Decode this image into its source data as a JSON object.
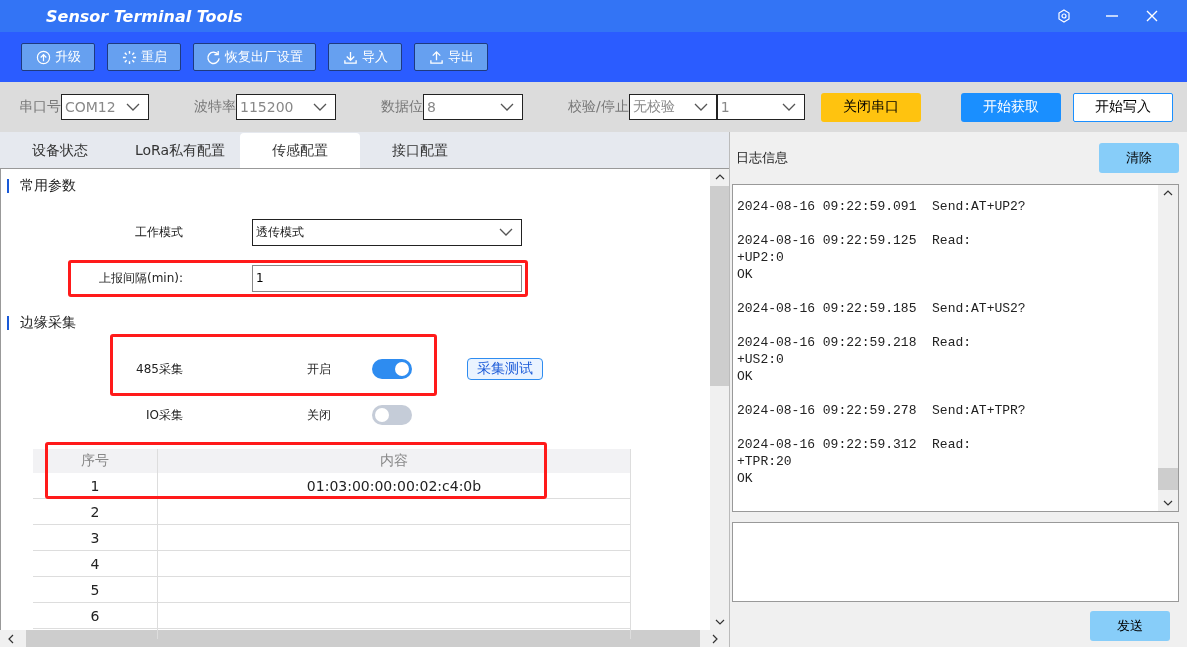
{
  "window": {
    "title": "Sensor Terminal Tools"
  },
  "toolbar": [
    {
      "label": "升级"
    },
    {
      "label": "重启"
    },
    {
      "label": "恢复出厂设置"
    },
    {
      "label": "导入"
    },
    {
      "label": "导出"
    }
  ],
  "serial": {
    "fields": [
      {
        "label": "串口号",
        "value": "COM12"
      },
      {
        "label": "波特率",
        "value": "115200"
      },
      {
        "label": "数据位",
        "value": "8"
      },
      {
        "label": "校验/停止",
        "value": "无校验"
      },
      {
        "value": "1"
      }
    ],
    "close_button": "关闭串口",
    "fetch_button": "开始获取",
    "write_button": "开始写入"
  },
  "tabs": [
    {
      "label": "设备状态",
      "selected": false
    },
    {
      "label": "LoRa私有配置",
      "selected": false
    },
    {
      "label": "传感配置",
      "selected": true
    },
    {
      "label": "接口配置",
      "selected": false
    }
  ],
  "sections": [
    {
      "title": "常用参数",
      "fields": [
        {
          "kind": "select",
          "label": "工作模式",
          "value": "透传模式"
        },
        {
          "kind": "input",
          "label": "上报间隔(min):",
          "value": "1"
        }
      ]
    },
    {
      "title": "边缘采集",
      "fields": [
        {
          "kind": "switch",
          "label": "485采集",
          "state": "开启",
          "on": true,
          "button": "采集测试"
        },
        {
          "kind": "switch",
          "label": "IO采集",
          "state": "关闭",
          "on": false
        }
      ]
    }
  ],
  "table": {
    "columns": [
      "序号",
      "内容"
    ],
    "rows": [
      [
        "1",
        "01:03:00:00:00:02:c4:0b"
      ],
      [
        "2",
        ""
      ],
      [
        "3",
        ""
      ],
      [
        "4",
        ""
      ],
      [
        "5",
        ""
      ],
      [
        "6",
        ""
      ]
    ]
  },
  "log": {
    "title": "日志信息",
    "clear_button": "清除",
    "send_button": "发送",
    "entries": [
      {
        "lines": [
          "2024-08-16 09:22:59.091  Send:AT+UP2?"
        ]
      },
      {
        "lines": [
          "2024-08-16 09:22:59.125  Read:",
          "+UP2:0",
          "OK"
        ]
      },
      {
        "lines": [
          "2024-08-16 09:22:59.185  Send:AT+US2?"
        ]
      },
      {
        "lines": [
          "2024-08-16 09:22:59.218  Read:",
          "+US2:0",
          "OK"
        ]
      },
      {
        "lines": [
          "2024-08-16 09:22:59.278  Send:AT+TPR?"
        ]
      },
      {
        "lines": [
          "2024-08-16 09:22:59.312  Read:",
          "+TPR:20",
          "OK"
        ]
      }
    ]
  }
}
